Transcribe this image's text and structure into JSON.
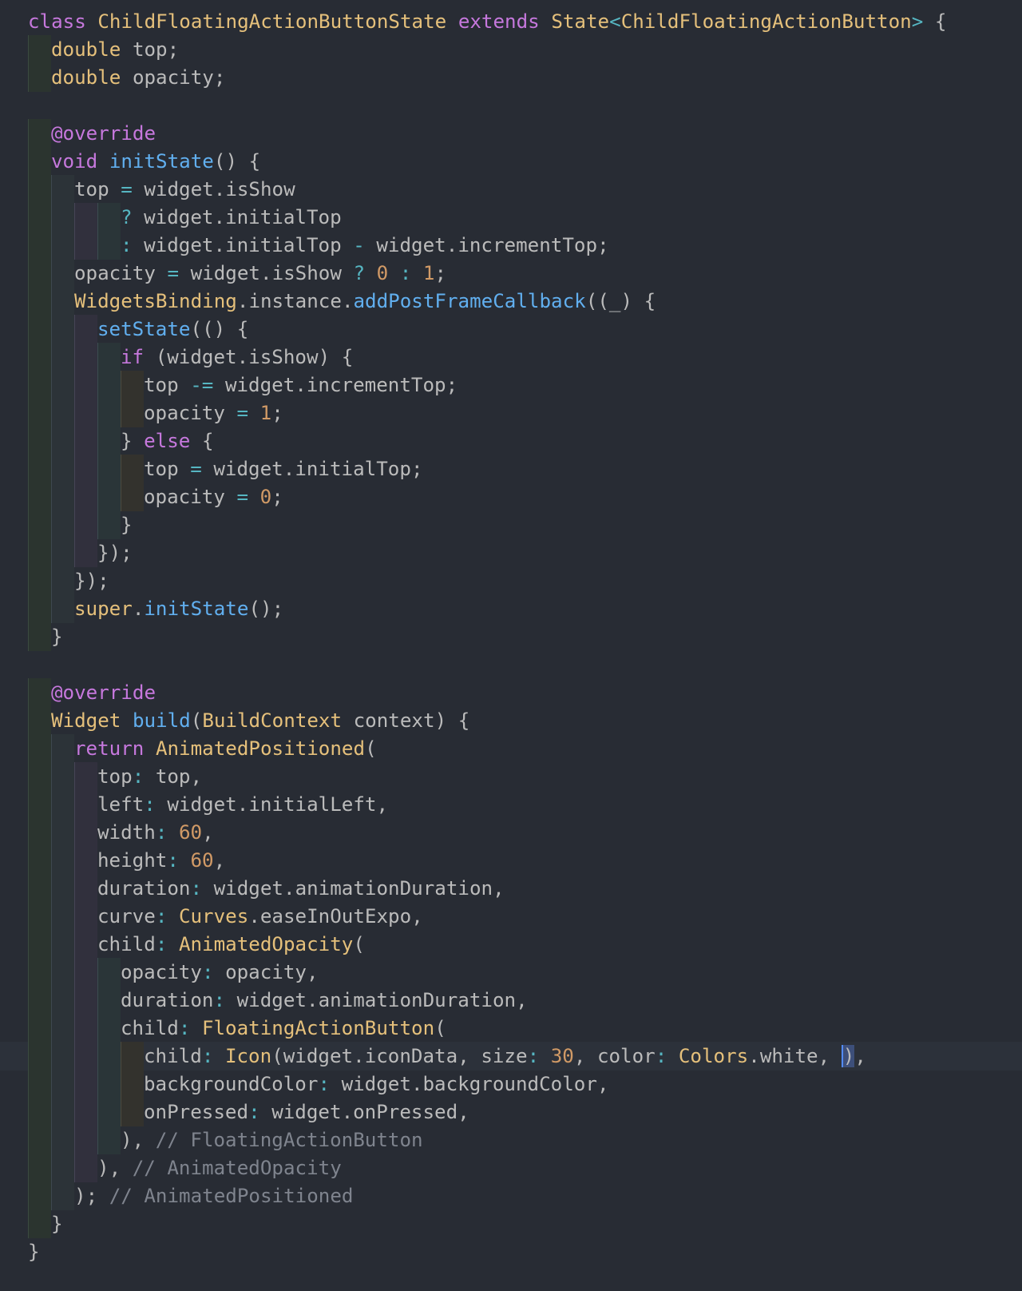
{
  "editor": {
    "language": "dart",
    "current_line": 38,
    "colors": {
      "background": "#282c34",
      "keyword": "#c678dd",
      "type": "#e5c07b",
      "function": "#61afef",
      "number": "#d19a66",
      "operator": "#56b6c2",
      "comment": "#7f848e",
      "plain": "#bbbbbb"
    },
    "gutter_icon": "lightbulb-icon",
    "lines": [
      "class ChildFloatingActionButtonState extends State<ChildFloatingActionButton> {",
      "  double top;",
      "  double opacity;",
      "",
      "  @override",
      "  void initState() {",
      "    top = widget.isShow",
      "        ? widget.initialTop",
      "        : widget.initialTop - widget.incrementTop;",
      "    opacity = widget.isShow ? 0 : 1;",
      "    WidgetsBinding.instance.addPostFrameCallback((_) {",
      "      setState(() {",
      "        if (widget.isShow) {",
      "          top -= widget.incrementTop;",
      "          opacity = 1;",
      "        } else {",
      "          top = widget.initialTop;",
      "          opacity = 0;",
      "        }",
      "      });",
      "    });",
      "    super.initState();",
      "  }",
      "",
      "  @override",
      "  Widget build(BuildContext context) {",
      "    return AnimatedPositioned(",
      "      top: top,",
      "      left: widget.initialLeft,",
      "      width: 60,",
      "      height: 60,",
      "      duration: widget.animationDuration,",
      "      curve: Curves.easeInOutExpo,",
      "      child: AnimatedOpacity(",
      "        opacity: opacity,",
      "        duration: widget.animationDuration,",
      "        child: FloatingActionButton(",
      "          child: Icon(widget.iconData, size: 30, color: Colors.white, ),",
      "          backgroundColor: widget.backgroundColor,",
      "          onPressed: widget.onPressed,",
      "        ), // FloatingActionButton",
      "      ), // AnimatedOpacity",
      "    ); // AnimatedPositioned",
      "  }",
      "}"
    ]
  }
}
